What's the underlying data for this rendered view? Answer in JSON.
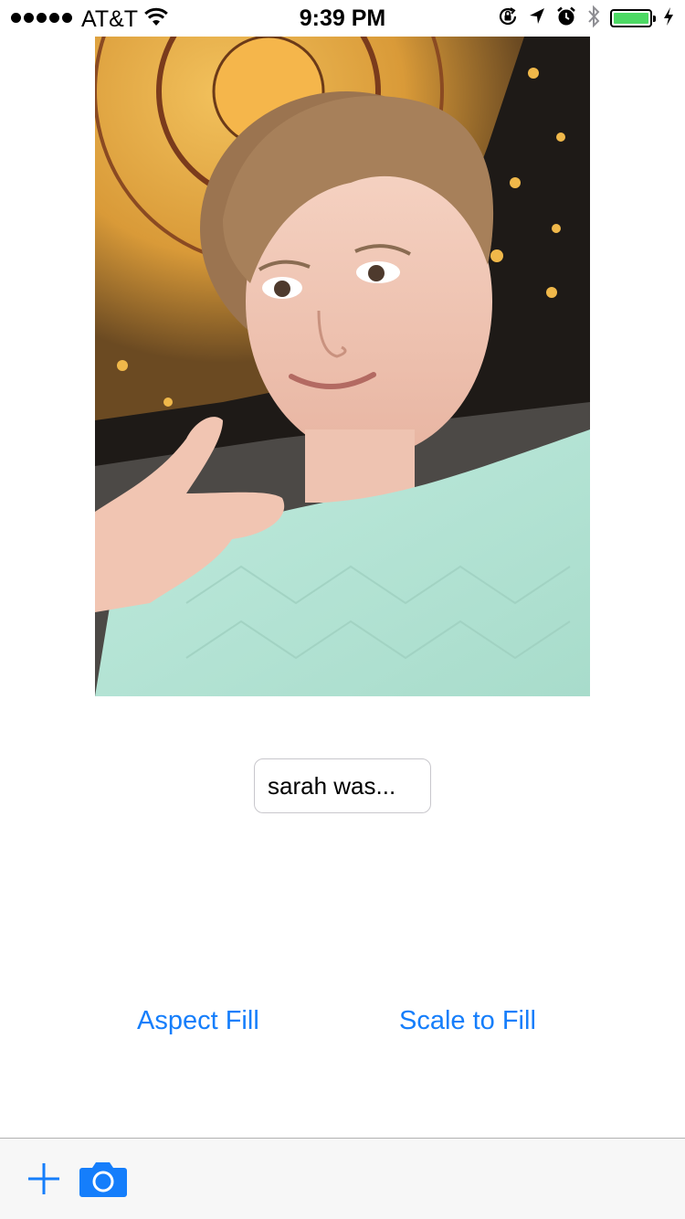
{
  "status_bar": {
    "carrier": "AT&T",
    "time": "9:39 PM",
    "battery_color": "#4cd964",
    "icons": [
      "signal-dots-icon",
      "wifi-icon",
      "orientation-lock-icon",
      "location-icon",
      "alarm-icon",
      "bluetooth-icon",
      "battery-icon",
      "charging-bolt-icon"
    ]
  },
  "photo": {
    "description_icon": "selfie-photo"
  },
  "caption_field": {
    "value": "sarah was..."
  },
  "buttons": {
    "aspect_fill": "Aspect Fill",
    "scale_to_fill": "Scale to Fill"
  },
  "toolbar": {
    "accent": "#157efb",
    "icons": [
      "plus-icon",
      "camera-icon"
    ]
  }
}
